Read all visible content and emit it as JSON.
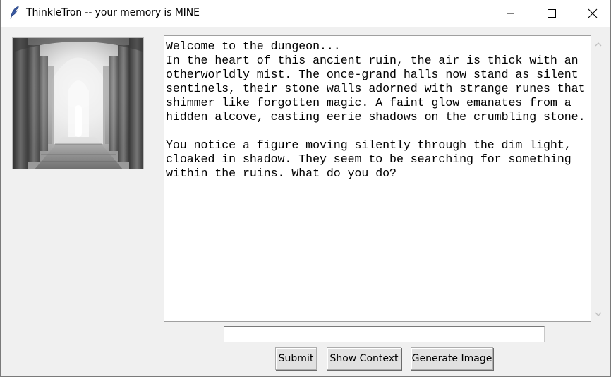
{
  "window": {
    "title": "ThinkleTron -- your memory is MINE",
    "icon": "feather-icon"
  },
  "story": {
    "lines": [
      "Welcome to the dungeon...",
      "In the heart of this ancient ruin, the air is thick with an",
      "otherworldly mist. The once-grand halls now stand as silent",
      "sentinels, their stone walls adorned with strange runes that",
      "shimmer like forgotten magic. A faint glow emanates from a",
      "hidden alcove, casting eerie shadows on the crumbling stone.",
      "",
      "You notice a figure moving silently through the dim light,",
      "cloaked in shadow. They seem to be searching for something",
      "within the ruins. What do you do?"
    ]
  },
  "input": {
    "value": "",
    "placeholder": ""
  },
  "buttons": {
    "submit": "Submit",
    "show_context": "Show Context",
    "generate_image": "Generate Image"
  }
}
